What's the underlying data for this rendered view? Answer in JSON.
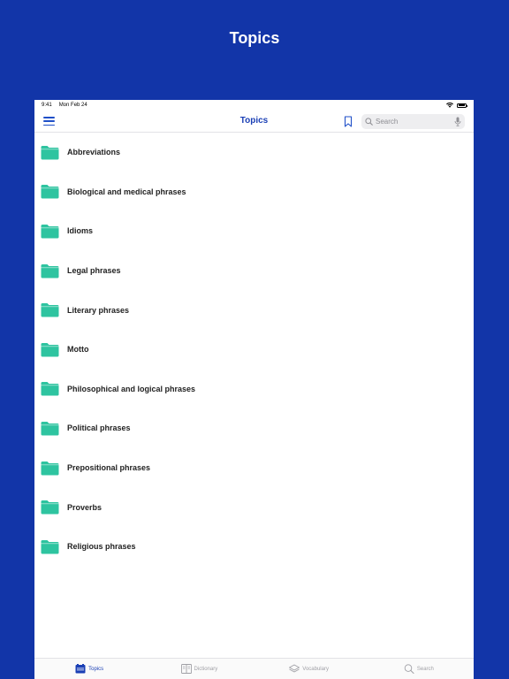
{
  "promo": {
    "title": "Topics"
  },
  "status_bar": {
    "time": "9:41",
    "date": "Mon Feb 24"
  },
  "nav": {
    "title": "Topics",
    "search_placeholder": "Search"
  },
  "colors": {
    "background": "#1235A8",
    "accent": "#1a3fb5",
    "folder": "#2ec4a0"
  },
  "topics": [
    {
      "label": "Abbreviations",
      "icon": "folder-icon"
    },
    {
      "label": "Biological and medical phrases",
      "icon": "folder-icon"
    },
    {
      "label": "Idioms",
      "icon": "folder-icon"
    },
    {
      "label": "Legal phrases",
      "icon": "folder-icon"
    },
    {
      "label": "Literary phrases",
      "icon": "folder-icon"
    },
    {
      "label": "Motto",
      "icon": "folder-icon"
    },
    {
      "label": "Philosophical and logical phrases",
      "icon": "folder-icon"
    },
    {
      "label": "Political phrases",
      "icon": "folder-icon"
    },
    {
      "label": "Prepositional phrases",
      "icon": "folder-icon"
    },
    {
      "label": "Proverbs",
      "icon": "folder-icon"
    },
    {
      "label": "Religious phrases",
      "icon": "folder-icon"
    }
  ],
  "tabs": [
    {
      "label": "Topics",
      "icon": "topics-icon",
      "active": true
    },
    {
      "label": "Dictionary",
      "icon": "dictionary-icon",
      "active": false
    },
    {
      "label": "Vocabulary",
      "icon": "vocabulary-icon",
      "active": false
    },
    {
      "label": "Search",
      "icon": "search-icon",
      "active": false
    }
  ]
}
